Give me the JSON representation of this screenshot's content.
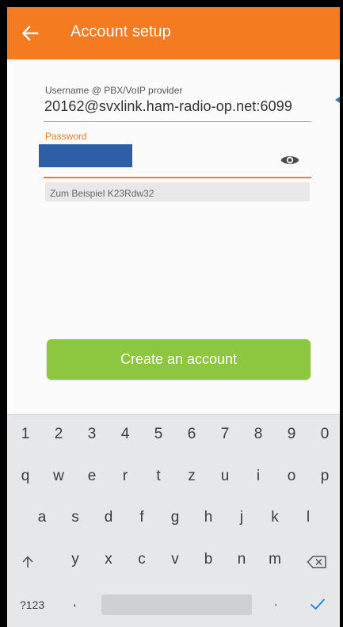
{
  "appbar": {
    "title": "Account setup",
    "back_icon": "arrow-left-icon",
    "color": "#f47b20"
  },
  "form": {
    "username_label": "Username @ PBX/VoIP provider",
    "username_value": "20162@svxlink.ham-radio-op.net:6099",
    "password_label": "Password",
    "password_value_redacted": true,
    "password_toggle_icon": "eye-icon",
    "hint": "Zum Beispiel K23Rdw32"
  },
  "create_button": {
    "label": "Create an account",
    "color": "#8dc63f"
  },
  "keyboard": {
    "row1": [
      "1",
      "2",
      "3",
      "4",
      "5",
      "6",
      "7",
      "8",
      "9",
      "0"
    ],
    "row2": [
      "q",
      "w",
      "e",
      "r",
      "t",
      "z",
      "u",
      "i",
      "o",
      "p"
    ],
    "row3": [
      "a",
      "s",
      "d",
      "f",
      "g",
      "h",
      "j",
      "k",
      "l"
    ],
    "row4": [
      "y",
      "x",
      "c",
      "v",
      "b",
      "n",
      "m"
    ],
    "shift_icon": "shift-arrow-icon",
    "backspace_icon": "backspace-icon",
    "symbols_label": "?123",
    "comma_label": ",",
    "period_label": ".",
    "done_icon": "checkmark-icon"
  }
}
